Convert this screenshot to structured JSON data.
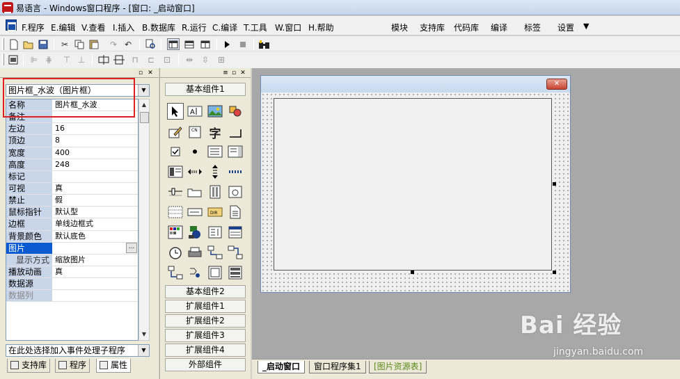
{
  "window": {
    "title": "易语言 - Windows窗口程序 - [窗口: _启动窗口]"
  },
  "menubar": {
    "items": [
      {
        "key": "F",
        "label": "F.程序"
      },
      {
        "key": "E",
        "label": "E.编辑"
      },
      {
        "key": "V",
        "label": "V.查看"
      },
      {
        "key": "I",
        "label": "I.插入"
      },
      {
        "key": "B",
        "label": "B.数据库"
      },
      {
        "key": "R",
        "label": "R.运行"
      },
      {
        "key": "C",
        "label": "C.编译"
      },
      {
        "key": "T",
        "label": "T.工具"
      },
      {
        "key": "W",
        "label": "W.窗口"
      },
      {
        "key": "H",
        "label": "H.帮助"
      }
    ],
    "right_items": [
      "模块",
      "支持库",
      "代码库",
      "编译",
      "标签",
      "设置"
    ],
    "dropdown_glyph": "▼"
  },
  "left_panel": {
    "object_combo": "图片框_水波（图片框）",
    "properties": [
      {
        "name": "名称",
        "value": "图片框_水波"
      },
      {
        "name": "备注",
        "value": ""
      },
      {
        "name": "左边",
        "value": "16"
      },
      {
        "name": "顶边",
        "value": "8"
      },
      {
        "name": "宽度",
        "value": "400"
      },
      {
        "name": "高度",
        "value": "248"
      },
      {
        "name": "标记",
        "value": ""
      },
      {
        "name": "可视",
        "value": "真"
      },
      {
        "name": "禁止",
        "value": "假"
      },
      {
        "name": "鼠标指针",
        "value": "默认型"
      },
      {
        "name": "边框",
        "value": "单线边框式"
      },
      {
        "name": "背景颜色",
        "value": "默认底色"
      },
      {
        "name": "图片",
        "value": ""
      },
      {
        "name": "显示方式",
        "value": "缩放图片"
      },
      {
        "name": "播放动画",
        "value": "真"
      },
      {
        "name": "数据源",
        "value": ""
      },
      {
        "name": "数据列",
        "value": ""
      }
    ],
    "event_combo": "在此处选择加入事件处理子程序",
    "tabs": [
      "支持库",
      "程序",
      "属性"
    ],
    "ellipsis": "..."
  },
  "toolbox": {
    "groups_top": [
      "基本组件1"
    ],
    "groups_bottom": [
      "基本组件2",
      "扩展组件1",
      "扩展组件2",
      "扩展组件3",
      "扩展组件4",
      "外部组件"
    ],
    "cells": [
      "pointer-tool",
      "label-tool",
      "picture-tool",
      "shape-tool",
      "edit-tool",
      "button-tool",
      "char-tool",
      "line-tool",
      "checkbox-tool",
      "radio-tool",
      "groupbox-tool",
      "listbox-tool",
      "combobox-tool",
      "scrollbar-tool",
      "spin-tool",
      "progress-tool",
      "slider-tool",
      "tab-tool",
      "vscroll-tool",
      "timer-tool",
      "grid-tool",
      "text-tool",
      "dir-tool",
      "file-tool",
      "color-tool",
      "chart-tool",
      "list-tool",
      "calendar-tool",
      "clock-tool",
      "printer-tool",
      "network-tool",
      "server-tool",
      "client-tool",
      "port-tool",
      "frame-tool",
      "data-tool"
    ],
    "cell_glyphs": {
      "label": "Aa",
      "char": "字",
      "cn": "CN",
      "dir": "DIR"
    }
  },
  "status_tabs": [
    "_启动窗口",
    "窗口程序集1",
    "[图片资源表]"
  ],
  "watermark": {
    "main": "Bai 经验",
    "url": "jingyan.baidu.com"
  },
  "colors": {
    "red_highlight": "#e02020",
    "selection": "#0a5bd2"
  }
}
